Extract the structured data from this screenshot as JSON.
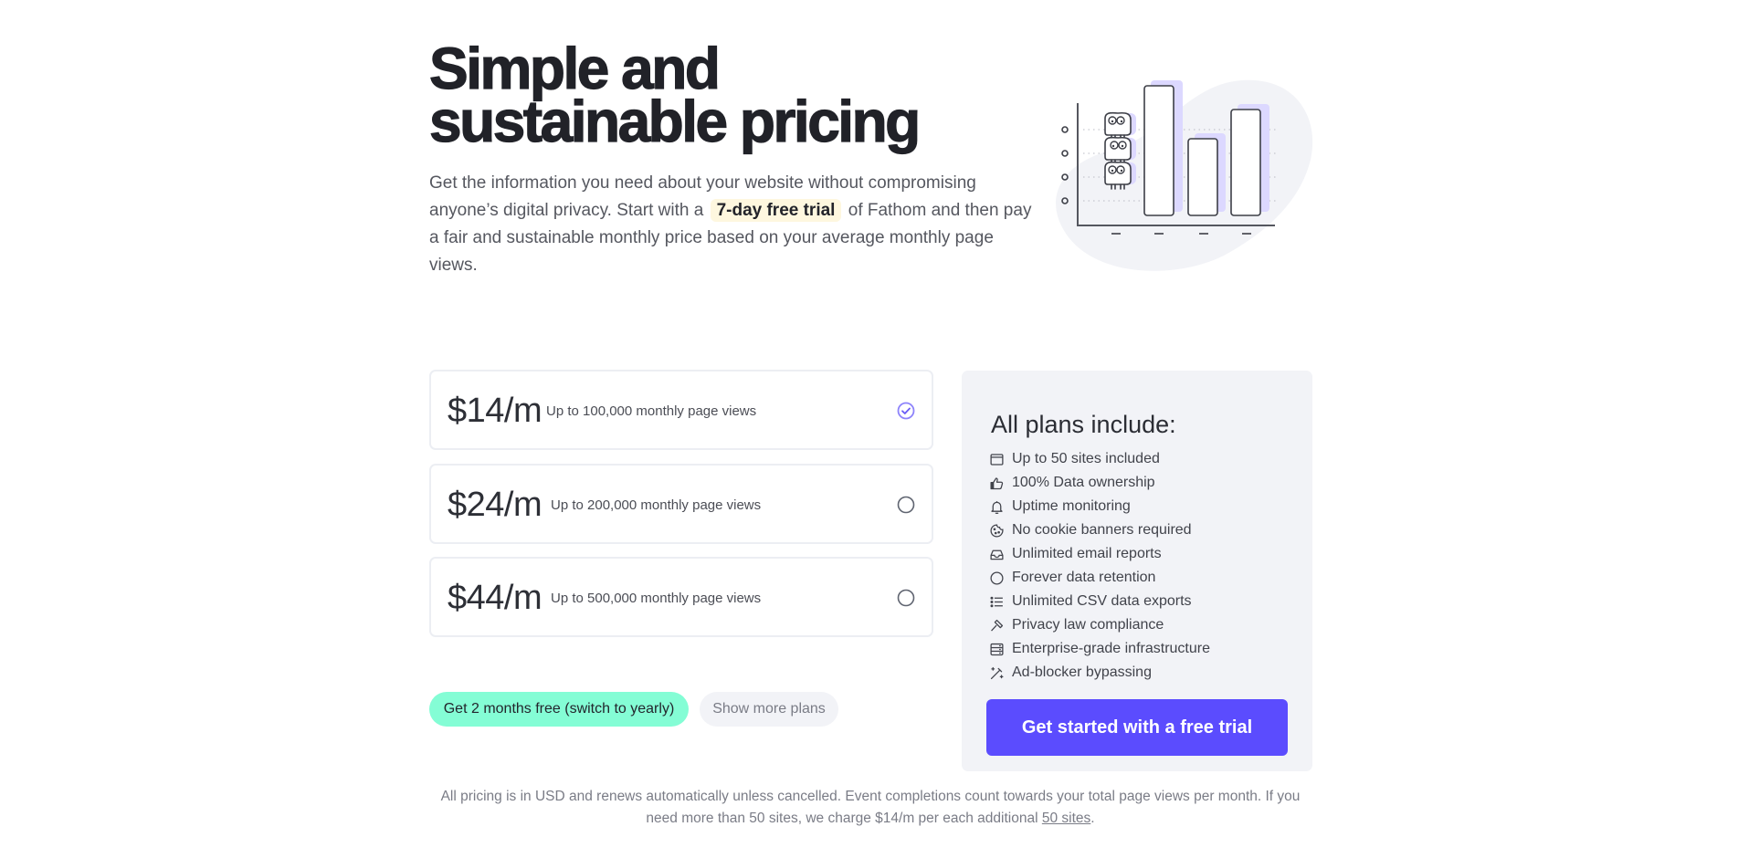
{
  "header": {
    "title_line1": "Simple and",
    "title_line2": "sustainable pricing",
    "intro_before": "Get the information you need about your website without compromising anyone’s digital privacy. Start with a",
    "intro_highlight": "7-day free trial",
    "intro_after": "of Fathom and then pay a fair and sustainable monthly price based on your average monthly page views."
  },
  "illustration": {
    "name": "bar-chart-with-monsters",
    "accent_color": "#dcd8ff",
    "blob_color": "#f2f3f7"
  },
  "plans": [
    {
      "price": "$14/m",
      "description": "Up to 100,000 monthly page views",
      "selected": true
    },
    {
      "price": "$24/m",
      "description": "Up to 200,000 monthly page views",
      "selected": false
    },
    {
      "price": "$44/m",
      "description": "Up to 500,000 monthly page views",
      "selected": false
    }
  ],
  "actions": {
    "yearly_label": "Get 2 months free (switch to yearly)",
    "more_plans_label": "Show more plans"
  },
  "features_panel": {
    "title": "All plans include:",
    "items": [
      {
        "icon": "browser-window-icon",
        "label": "Up to 50 sites included"
      },
      {
        "icon": "thumbs-up-icon",
        "label": "100% Data ownership"
      },
      {
        "icon": "bell-icon",
        "label": "Uptime monitoring"
      },
      {
        "icon": "cookie-icon",
        "label": "No cookie banners required"
      },
      {
        "icon": "inbox-icon",
        "label": "Unlimited email reports"
      },
      {
        "icon": "circle-icon",
        "label": "Forever data retention"
      },
      {
        "icon": "list-icon",
        "label": "Unlimited CSV data exports"
      },
      {
        "icon": "gavel-icon",
        "label": "Privacy law compliance"
      },
      {
        "icon": "server-icon",
        "label": "Enterprise-grade infrastructure"
      },
      {
        "icon": "magic-wand-icon",
        "label": "Ad-blocker bypassing"
      }
    ],
    "cta_label": "Get started with a free trial"
  },
  "footnote": {
    "text": "All pricing is in USD and renews automatically unless cancelled. Event completions count towards your total page views per month. If you need more than 50 sites, we charge $14/m per each additional",
    "link_label": "50 sites",
    "end": "."
  },
  "colors": {
    "accent": "#5b4cfe",
    "selected_border": "#8d83fb",
    "yearly_button": "#84fdd5",
    "panel_bg": "#f2f3f7",
    "highlight_bg": "#fef7df"
  }
}
